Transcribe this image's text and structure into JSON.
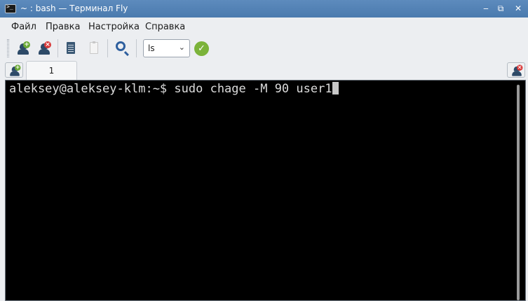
{
  "window": {
    "title": "~ : bash — Терминал Fly",
    "controls": {
      "minimize": "‒",
      "maximize": "⧉",
      "close": "✕"
    }
  },
  "menu": [
    "Файл",
    "Правка",
    "Настройка",
    "Справка"
  ],
  "toolbar": {
    "new_session_icon": "add-user-icon",
    "close_session_icon": "remove-user-icon",
    "copy_icon": "copy-icon",
    "paste_icon": "paste-icon",
    "search_icon": "search-icon",
    "command_select_value": "ls",
    "command_select_arrow": "⌄",
    "execute_icon": "check-icon",
    "execute_glyph": "✓"
  },
  "tabs": [
    {
      "label": "1"
    }
  ],
  "terminal": {
    "prompt": "aleksey@aleksey-klm:~$ ",
    "command": "sudo chage -M 90 user1"
  },
  "colors": {
    "titlebar": "#4a7aae",
    "terminal_bg": "#000000",
    "terminal_fg": "#dcdcdc",
    "add_badge": "#6aa834",
    "remove_badge": "#d83a3a",
    "search": "#2e5f9e"
  }
}
